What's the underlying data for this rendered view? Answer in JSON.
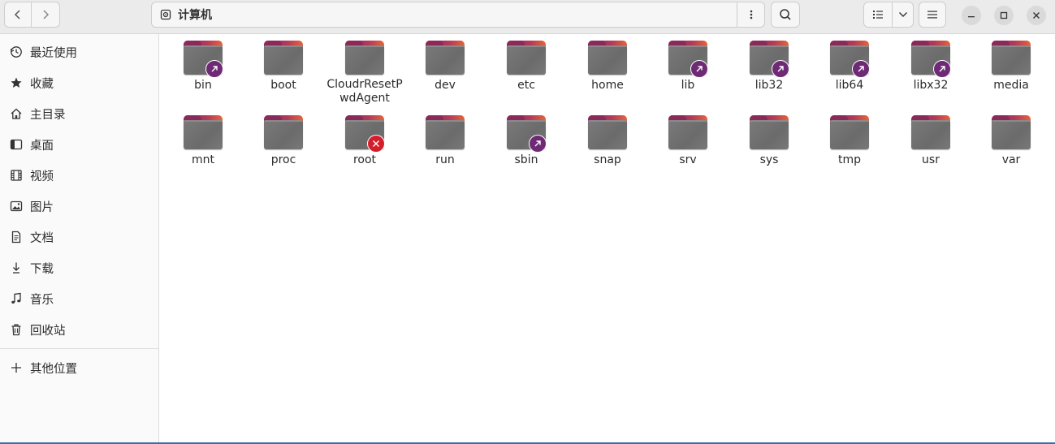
{
  "header": {
    "location_title": "计算机",
    "location_icon": "computer-icon"
  },
  "sidebar": {
    "items": [
      {
        "label": "最近使用",
        "icon": "clock-icon"
      },
      {
        "label": "收藏",
        "icon": "star-icon"
      },
      {
        "label": "主目录",
        "icon": "home-icon"
      },
      {
        "label": "桌面",
        "icon": "desktop-icon"
      },
      {
        "label": "视频",
        "icon": "film-icon"
      },
      {
        "label": "图片",
        "icon": "image-icon"
      },
      {
        "label": "文档",
        "icon": "document-icon"
      },
      {
        "label": "下载",
        "icon": "download-icon"
      },
      {
        "label": "音乐",
        "icon": "music-icon"
      },
      {
        "label": "回收站",
        "icon": "trash-icon"
      }
    ],
    "other_locations": {
      "label": "其他位置",
      "icon": "plus-icon"
    }
  },
  "files": [
    {
      "name": "bin",
      "emblem": "link"
    },
    {
      "name": "boot",
      "emblem": ""
    },
    {
      "name": "CloudrResetPwdAgent",
      "emblem": ""
    },
    {
      "name": "dev",
      "emblem": ""
    },
    {
      "name": "etc",
      "emblem": ""
    },
    {
      "name": "home",
      "emblem": ""
    },
    {
      "name": "lib",
      "emblem": "link"
    },
    {
      "name": "lib32",
      "emblem": "link"
    },
    {
      "name": "lib64",
      "emblem": "link"
    },
    {
      "name": "libx32",
      "emblem": "link"
    },
    {
      "name": "media",
      "emblem": ""
    },
    {
      "name": "mnt",
      "emblem": ""
    },
    {
      "name": "proc",
      "emblem": ""
    },
    {
      "name": "root",
      "emblem": "noaccess"
    },
    {
      "name": "run",
      "emblem": ""
    },
    {
      "name": "sbin",
      "emblem": "link"
    },
    {
      "name": "snap",
      "emblem": ""
    },
    {
      "name": "srv",
      "emblem": ""
    },
    {
      "name": "sys",
      "emblem": ""
    },
    {
      "name": "tmp",
      "emblem": ""
    },
    {
      "name": "usr",
      "emblem": ""
    },
    {
      "name": "var",
      "emblem": ""
    }
  ],
  "colors": {
    "folder_tab": "#b13a5a",
    "folder_body": "#6f6f6f",
    "emblem_link": "#6e2a75",
    "emblem_noaccess": "#d41f2b"
  }
}
